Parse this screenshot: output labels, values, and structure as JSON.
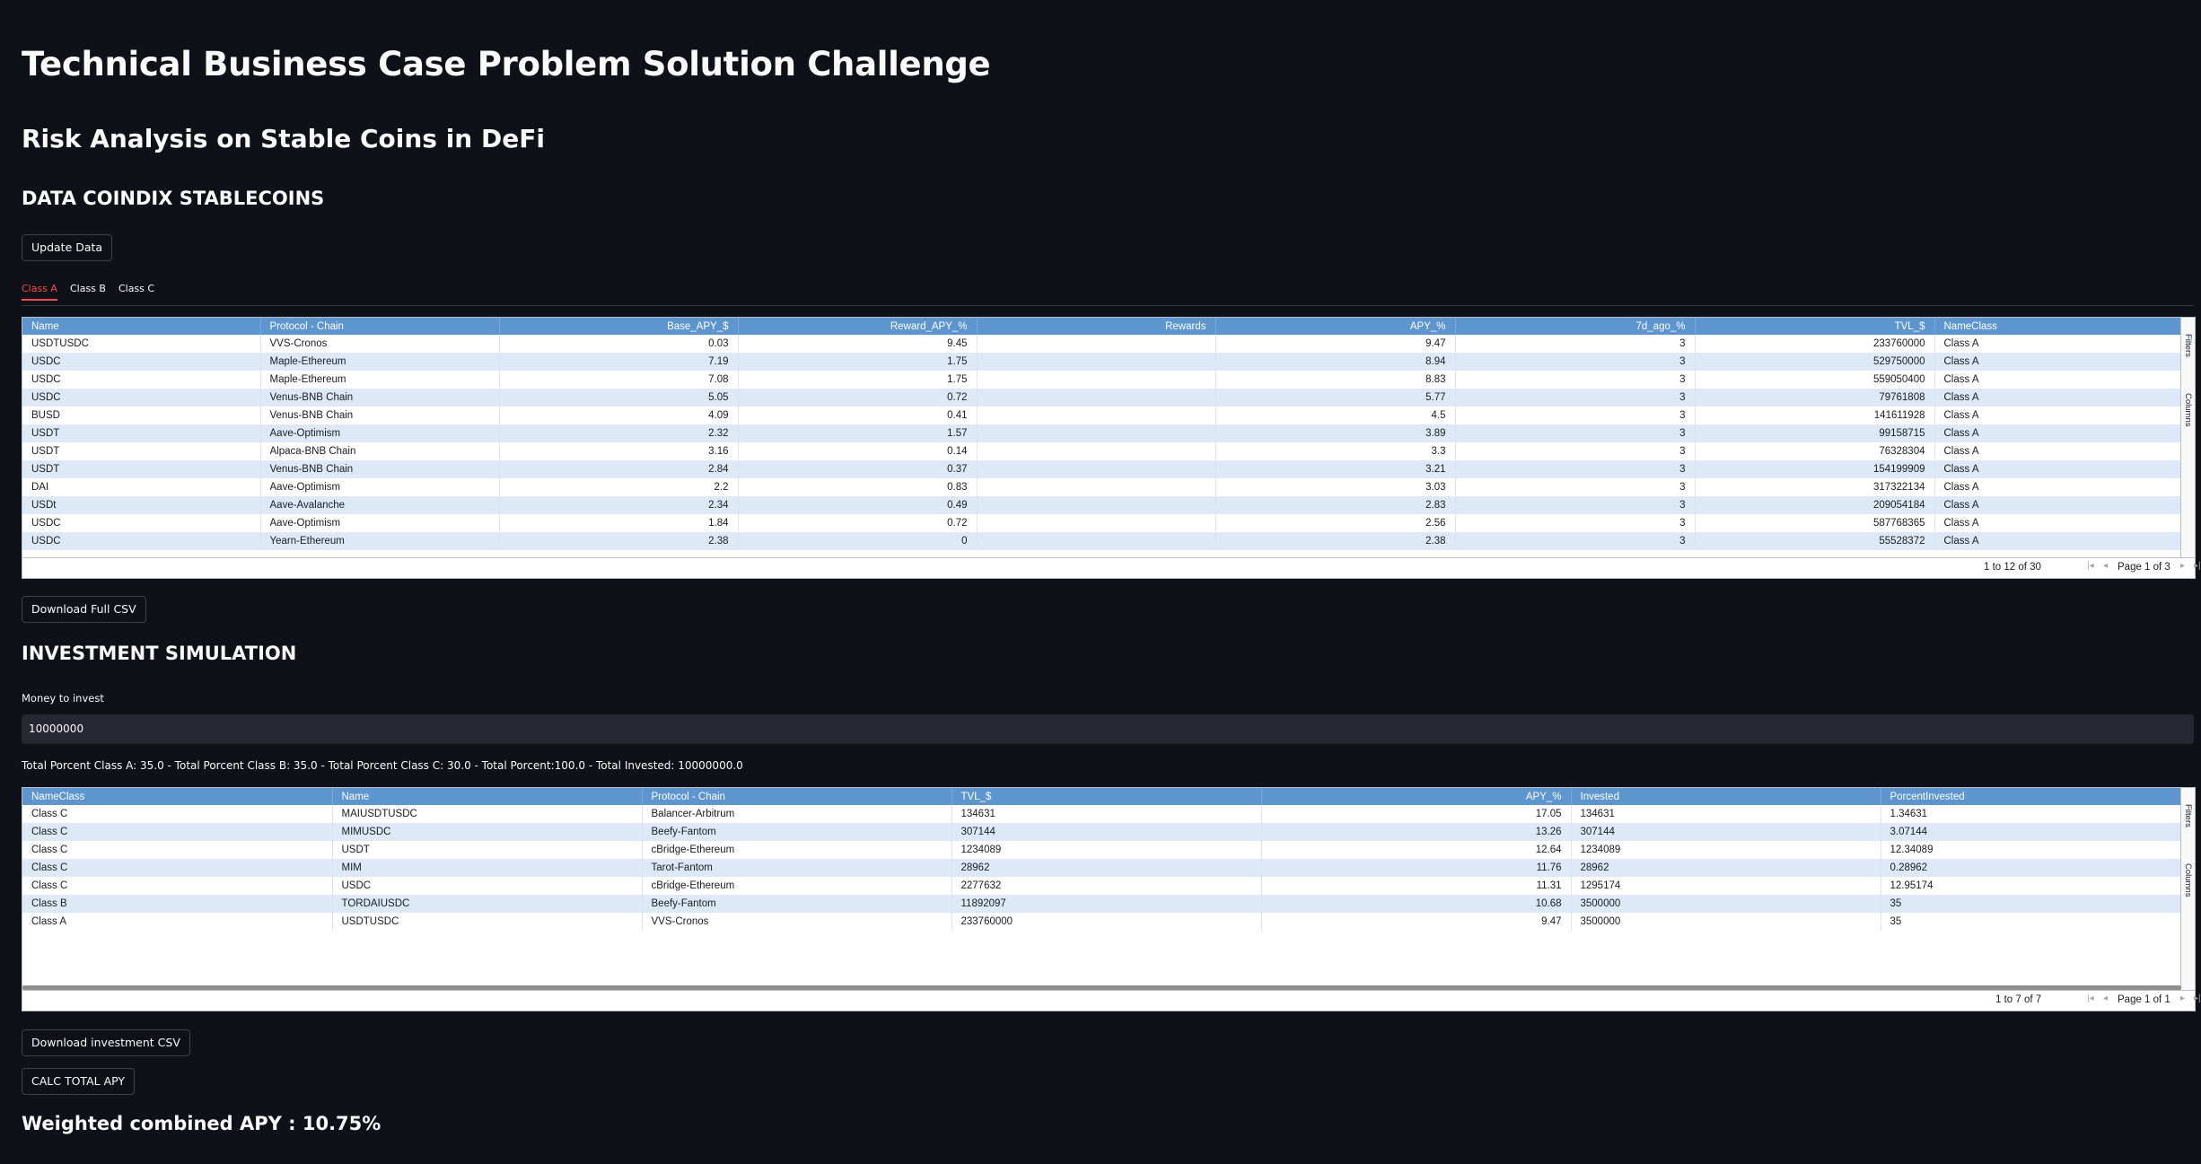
{
  "title": "Technical Business Case Problem Solution Challenge",
  "subtitle": "Risk Analysis on Stable Coins in DeFi",
  "section1": {
    "heading": "DATA COINDIX STABLECOINS",
    "update_button": "Update Data",
    "tabs": [
      "Class A",
      "Class B",
      "Class C"
    ],
    "active_tab": "Class A",
    "grid": {
      "columns": [
        "Name",
        "Protocol - Chain",
        "Base_APY_$",
        "Reward_APY_%",
        "Rewards",
        "APY_%",
        "7d_ago_%",
        "TVL_$",
        "NameClass"
      ],
      "rows": [
        [
          "USDTUSDC",
          "VVS-Cronos",
          "0.03",
          "9.45",
          "",
          "9.47",
          "3",
          "233760000",
          "Class A"
        ],
        [
          "USDC",
          "Maple-Ethereum",
          "7.19",
          "1.75",
          "",
          "8.94",
          "3",
          "529750000",
          "Class A"
        ],
        [
          "USDC",
          "Maple-Ethereum",
          "7.08",
          "1.75",
          "",
          "8.83",
          "3",
          "559050400",
          "Class A"
        ],
        [
          "USDC",
          "Venus-BNB Chain",
          "5.05",
          "0.72",
          "",
          "5.77",
          "3",
          "79761808",
          "Class A"
        ],
        [
          "BUSD",
          "Venus-BNB Chain",
          "4.09",
          "0.41",
          "",
          "4.5",
          "3",
          "141611928",
          "Class A"
        ],
        [
          "USDT",
          "Aave-Optimism",
          "2.32",
          "1.57",
          "",
          "3.89",
          "3",
          "99158715",
          "Class A"
        ],
        [
          "USDT",
          "Alpaca-BNB Chain",
          "3.16",
          "0.14",
          "",
          "3.3",
          "3",
          "76328304",
          "Class A"
        ],
        [
          "USDT",
          "Venus-BNB Chain",
          "2.84",
          "0.37",
          "",
          "3.21",
          "3",
          "154199909",
          "Class A"
        ],
        [
          "DAI",
          "Aave-Optimism",
          "2.2",
          "0.83",
          "",
          "3.03",
          "3",
          "317322134",
          "Class A"
        ],
        [
          "USDt",
          "Aave-Avalanche",
          "2.34",
          "0.49",
          "",
          "2.83",
          "3",
          "209054184",
          "Class A"
        ],
        [
          "USDC",
          "Aave-Optimism",
          "1.84",
          "0.72",
          "",
          "2.56",
          "3",
          "587768365",
          "Class A"
        ],
        [
          "USDC",
          "Yearn-Ethereum",
          "2.38",
          "0",
          "",
          "2.38",
          "3",
          "55528372",
          "Class A"
        ]
      ],
      "summary": "1 to 12 of 30",
      "page": "Page 1 of 3",
      "side_filters": "Filters",
      "side_columns": "Columns"
    },
    "download_button": "Download Full CSV"
  },
  "section2": {
    "heading": "INVESTMENT SIMULATION",
    "input_label": "Money to invest",
    "input_value": "10000000",
    "totals_text": "Total Porcent Class A: 35.0 - Total Porcent Class B: 35.0 - Total Porcent Class C: 30.0 - Total Porcent:100.0 - Total Invested: 10000000.0",
    "grid": {
      "columns": [
        "NameClass",
        "Name",
        "Protocol - Chain",
        "TVL_$",
        "APY_%",
        "Invested",
        "PorcentInvested"
      ],
      "rows": [
        [
          "Class C",
          "MAIUSDTUSDC",
          "Balancer-Arbitrum",
          "134631",
          "17.05",
          "134631",
          "1.34631"
        ],
        [
          "Class C",
          "MIMUSDC",
          "Beefy-Fantom",
          "307144",
          "13.26",
          "307144",
          "3.07144"
        ],
        [
          "Class C",
          "USDT",
          "cBridge-Ethereum",
          "1234089",
          "12.64",
          "1234089",
          "12.34089"
        ],
        [
          "Class C",
          "MIM",
          "Tarot-Fantom",
          "28962",
          "11.76",
          "28962",
          "0.28962"
        ],
        [
          "Class C",
          "USDC",
          "cBridge-Ethereum",
          "2277632",
          "11.31",
          "1295174",
          "12.95174"
        ],
        [
          "Class B",
          "TORDAIUSDC",
          "Beefy-Fantom",
          "11892097",
          "10.68",
          "3500000",
          "35"
        ],
        [
          "Class A",
          "USDTUSDC",
          "VVS-Cronos",
          "233760000",
          "9.47",
          "3500000",
          "35"
        ]
      ],
      "summary": "1 to 7 of 7",
      "page": "Page 1 of 1",
      "side_filters": "Filters",
      "side_columns": "Columns"
    },
    "download_button": "Download investment CSV",
    "calc_button": "CALC TOTAL APY",
    "result": "Weighted combined APY : 10.75%"
  },
  "colors": {
    "background": "#0e1117",
    "accent": "#ff4b4b",
    "grid_header": "#5d95cf",
    "grid_stripe": "#dde9f6"
  }
}
